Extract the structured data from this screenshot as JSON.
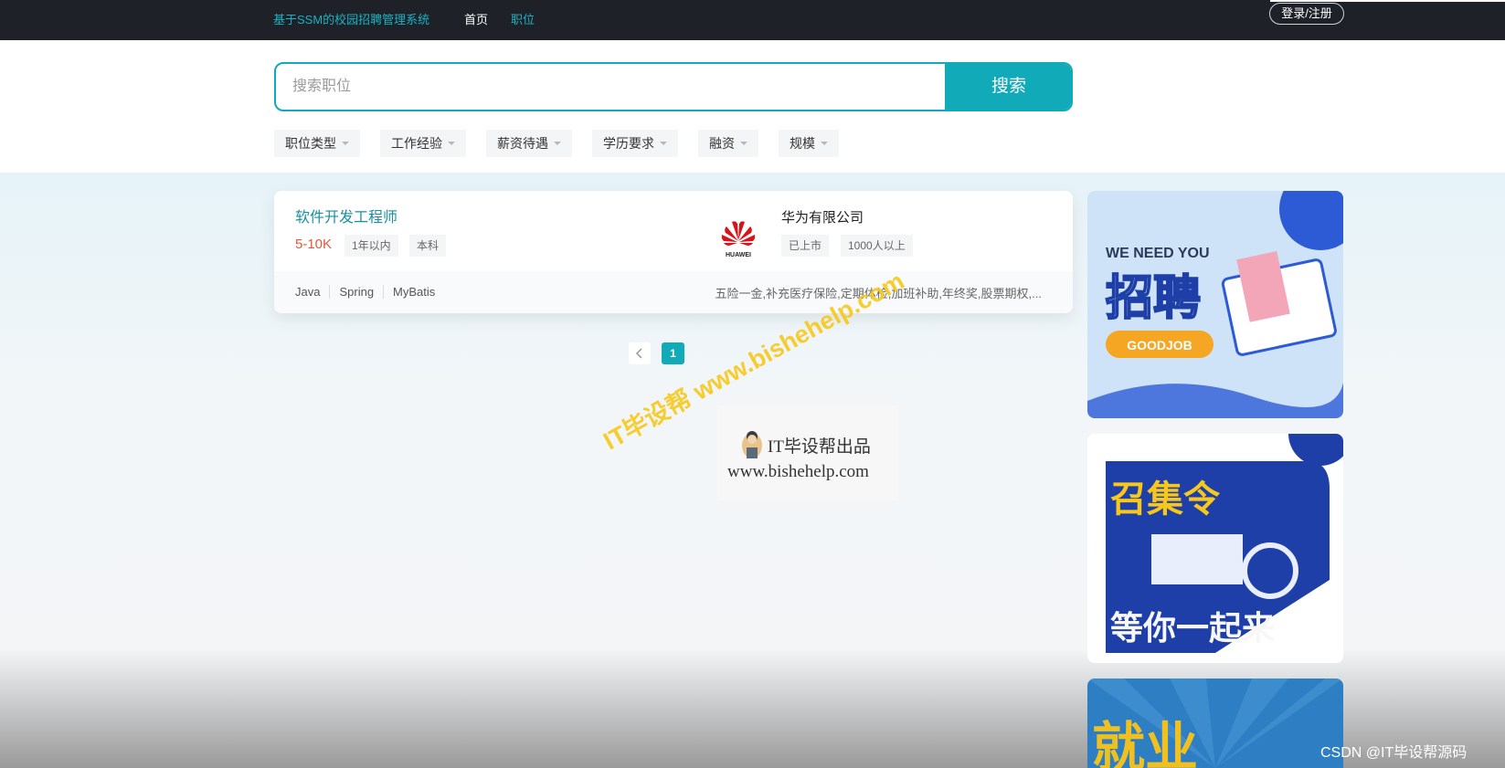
{
  "nav": {
    "brand": "基于SSM的校园招聘管理系统",
    "home": "首页",
    "jobs": "职位",
    "login": "登录/注册"
  },
  "search": {
    "placeholder": "搜索职位",
    "value": "",
    "button": "搜索"
  },
  "filters": [
    "职位类型",
    "工作经验",
    "薪资待遇",
    "学历要求",
    "融资",
    "规模"
  ],
  "job": {
    "title": "软件开发工程师",
    "salary": "5-10K",
    "experience": "1年以内",
    "education": "本科",
    "company_name": "华为有限公司",
    "company_logo_text": "HUAWEI",
    "company_status": "已上市",
    "company_size": "1000人以上",
    "skills": [
      "Java",
      "Spring",
      "MyBatis"
    ],
    "benefits": "五险一金,补充医疗保险,定期体检,加班补助,年终奖,股票期权,..."
  },
  "pagination": {
    "prev_icon": "chevron-left-icon",
    "current": "1"
  },
  "watermark": {
    "diagonal": "IT毕设帮 www.bishehelp.com",
    "stamp_line1": "IT毕设帮出品",
    "stamp_line2": "www.bishehelp.com"
  },
  "banners": {
    "banner1": {
      "line1": "WE NEED YOU",
      "line2": "招聘",
      "button": "GOODJOB"
    },
    "banner2": {
      "line1": "召集令",
      "line2": "等你一起来"
    },
    "banner3": {
      "line1": "就业"
    }
  },
  "footer_watermark": "CSDN @IT毕设帮源码",
  "colors": {
    "accent": "#11aab8",
    "nav_bg": "#1e2127",
    "salary": "#e0593b"
  }
}
